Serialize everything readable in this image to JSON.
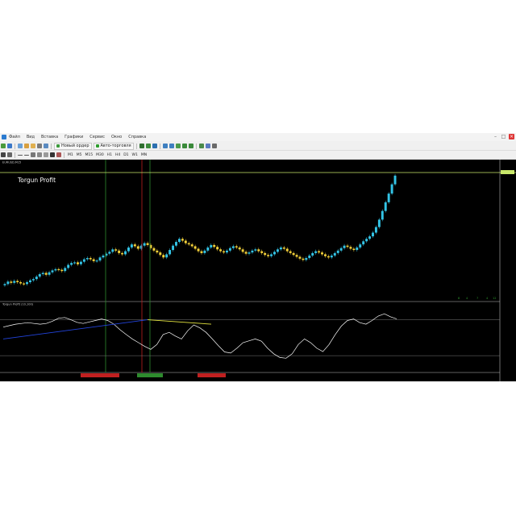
{
  "menubar": {
    "items": [
      "Файл",
      "Вид",
      "Вставка",
      "Графики",
      "Сервис",
      "Окно",
      "Справка"
    ]
  },
  "toolbar1": {
    "new_order_label": "Новый ордер",
    "autotrading_label": "Авто-торговля"
  },
  "toolbar2": {
    "timeframes": [
      "M1",
      "M5",
      "M15",
      "M30",
      "H1",
      "H4",
      "D1",
      "W1",
      "MN"
    ]
  },
  "chart": {
    "symbol_label": "EURUSD,M15",
    "watermark": "Torgun Profit",
    "indicator_label": "Torgun Profit (10,100)",
    "bottom_right_counts": [
      "8",
      "4",
      "7",
      "4",
      "12"
    ],
    "colors": {
      "background": "#000000",
      "bull_candle": "#33c4e6",
      "bear_candle": "#f5d23a",
      "mixed_candle": "#8b1a1a",
      "price_line": "#c9e86a",
      "vline_green": "#2e8b2e",
      "vline_red": "#c02020",
      "osc_line": "#ffffff",
      "trend_blue": "#2244dd",
      "trend_yellow": "#e6e640"
    }
  },
  "chart_data": [
    {
      "type": "candlestick",
      "title": "EURUSD,M15",
      "series_trend": "close",
      "close": [
        0.0,
        0.4,
        0.2,
        0.5,
        0.3,
        0.1,
        0.0,
        0.3,
        0.6,
        0.8,
        1.2,
        1.6,
        1.8,
        1.5,
        1.9,
        2.2,
        2.4,
        2.3,
        2.1,
        2.6,
        3.1,
        3.4,
        3.5,
        3.2,
        3.6,
        4.0,
        4.2,
        4.0,
        3.7,
        3.8,
        4.3,
        4.6,
        4.9,
        5.2,
        5.6,
        5.4,
        5.0,
        4.8,
        5.3,
        5.9,
        6.4,
        6.1,
        5.7,
        6.2,
        6.6,
        6.3,
        5.8,
        5.4,
        5.1,
        4.7,
        4.3,
        4.8,
        5.5,
        6.2,
        6.8,
        7.3,
        7.0,
        6.6,
        6.4,
        6.1,
        5.7,
        5.3,
        5.0,
        5.4,
        5.9,
        6.3,
        6.0,
        5.6,
        5.3,
        5.1,
        5.4,
        5.8,
        6.1,
        5.9,
        5.6,
        5.2,
        4.9,
        5.1,
        5.4,
        5.6,
        5.3,
        5.0,
        4.7,
        4.5,
        4.8,
        5.2,
        5.6,
        5.9,
        5.7,
        5.3,
        5.0,
        4.7,
        4.4,
        4.1,
        3.9,
        4.2,
        4.6,
        5.0,
        5.3,
        5.1,
        4.8,
        4.5,
        4.3,
        4.6,
        5.0,
        5.4,
        5.8,
        6.2,
        6.0,
        5.7,
        5.5,
        5.9,
        6.4,
        6.9,
        7.3,
        7.7,
        8.3,
        9.2,
        10.4,
        11.8,
        13.2,
        14.6,
        16.1,
        17.5
      ]
    },
    {
      "type": "line",
      "title": "Torgun Profit (10,100)",
      "oscillator": [
        0.62,
        0.66,
        0.7,
        0.72,
        0.74,
        0.72,
        0.7,
        0.72,
        0.78,
        0.86,
        0.88,
        0.82,
        0.75,
        0.72,
        0.76,
        0.8,
        0.84,
        0.8,
        0.7,
        0.55,
        0.42,
        0.3,
        0.2,
        0.1,
        0.02,
        0.15,
        0.42,
        0.48,
        0.38,
        0.3,
        0.52,
        0.68,
        0.6,
        0.48,
        0.3,
        0.12,
        -0.05,
        -0.08,
        0.05,
        0.2,
        0.25,
        0.3,
        0.24,
        0.05,
        -0.1,
        -0.2,
        -0.22,
        -0.1,
        0.15,
        0.3,
        0.2,
        0.05,
        -0.04,
        0.15,
        0.42,
        0.65,
        0.8,
        0.84,
        0.74,
        0.7,
        0.8,
        0.92,
        0.98,
        0.9,
        0.84
      ],
      "trend_blue": [
        0.3,
        0.82
      ],
      "trend_yellow": [
        0.82,
        0.7
      ]
    }
  ]
}
